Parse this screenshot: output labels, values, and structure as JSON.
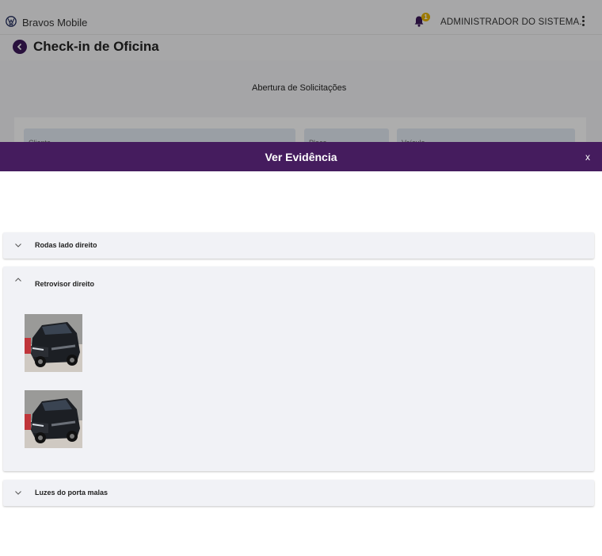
{
  "app": {
    "brand": "Bravos Mobile",
    "notification_count": "1",
    "user_name": "ADMINISTRADOR DO SISTEMA.",
    "page_title": "Check-in de Oficina",
    "section_title": "Abertura de Solicitações",
    "field_labels": [
      "Cliente",
      "Placa",
      "Veículo"
    ],
    "colors": {
      "primary": "#451c5e",
      "badge": "#e6b300"
    }
  },
  "modal": {
    "title": "Ver Evidência",
    "close_label": "x",
    "panels": [
      {
        "label": "Rodas lado direito",
        "expanded": false,
        "icon": "chevron-down-icon"
      },
      {
        "label": "Retrovisor direito",
        "expanded": true,
        "icon": "chevron-up-icon",
        "images": 2
      },
      {
        "label": "Luzes do porta malas",
        "expanded": false,
        "icon": "chevron-down-icon"
      }
    ]
  }
}
